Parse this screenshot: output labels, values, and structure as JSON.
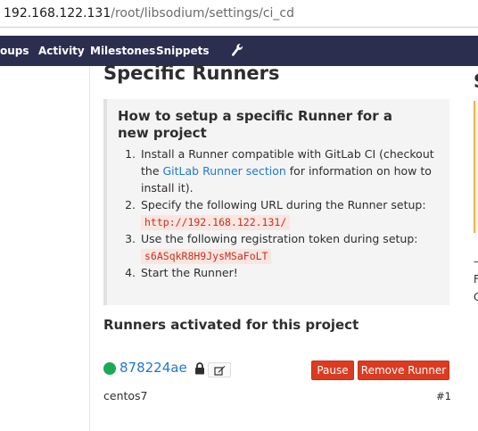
{
  "browser": {
    "url_host": "192.168.122.131",
    "url_path": "/root/libsodium/settings/ci_cd"
  },
  "nav": {
    "items": [
      "oups",
      "Activity",
      "Milestones",
      "Snippets"
    ],
    "admin_icon": "wrench-icon",
    "background_color": "#2c2e4f"
  },
  "right_panel": {
    "title_fragment": "S",
    "line_fragments": [
      "–",
      "F",
      "C"
    ]
  },
  "specific_runners": {
    "title": "Specific Runners",
    "howto_title": "How to setup a specific Runner for a new project",
    "step1_pre": "Install a Runner compatible with GitLab CI (checkout the ",
    "step1_link": "GitLab Runner section",
    "step1_post": " for information on how to install it).",
    "step2_text": "Specify the following URL during the Runner setup:",
    "step2_code": "http://192.168.122.131/",
    "step3_text": "Use the following registration token during setup:",
    "step3_code": "s6ASqkR8H9JysMSaFoLT",
    "step4_text": "Start the Runner!"
  },
  "activated": {
    "title": "Runners activated for this project",
    "runner": {
      "id": "878224ae",
      "status_color": "#1aaa55",
      "locked_icon": "lock-icon",
      "edit_icon": "edit-icon",
      "pause_label": "Pause",
      "remove_label": "Remove Runner",
      "description": "centos7",
      "number": "#1"
    }
  },
  "colors": {
    "link": "#1f78d1",
    "danger": "#db3b21",
    "code_text": "#c0341d"
  }
}
